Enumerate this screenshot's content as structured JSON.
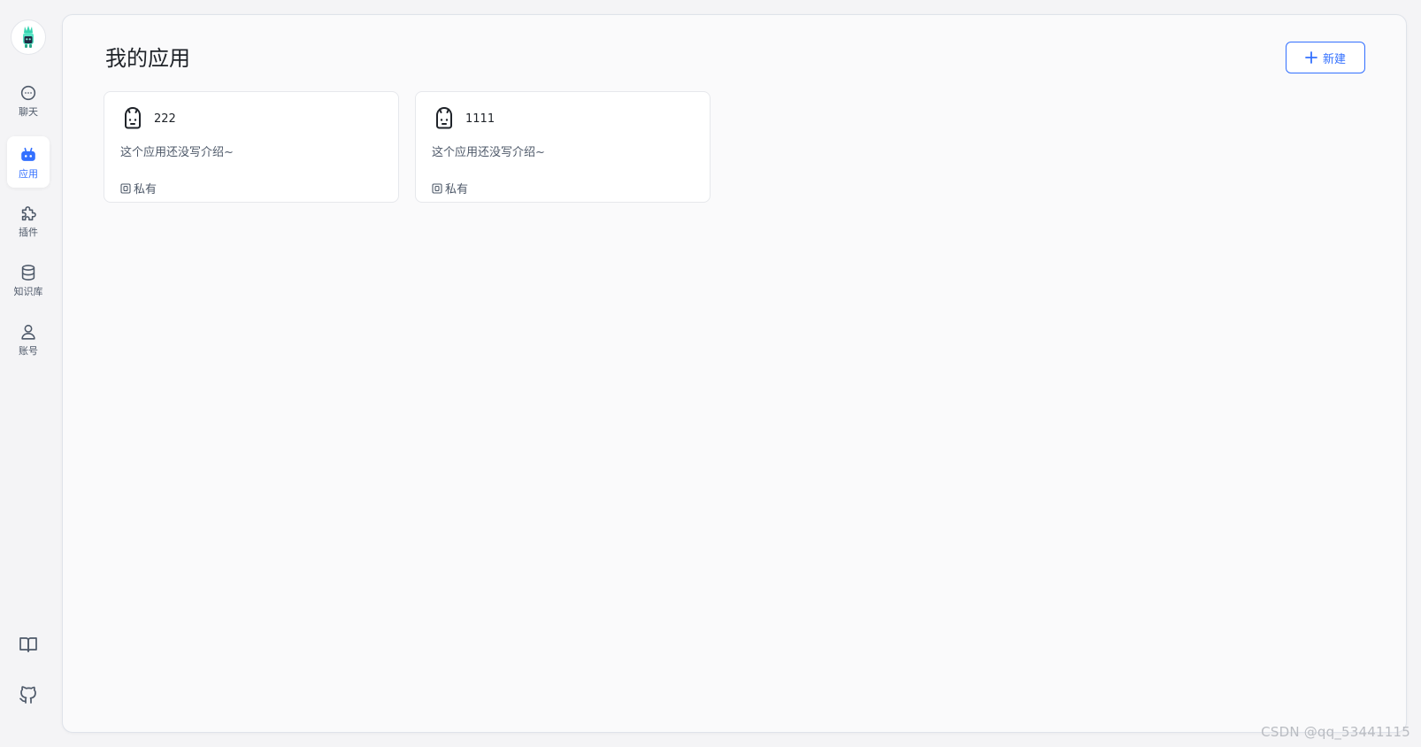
{
  "sidebar": {
    "avatar_icon": "app-logo-icon",
    "items": [
      {
        "label": "聊天",
        "icon": "chat-icon",
        "active": false
      },
      {
        "label": "应用",
        "icon": "robot-icon",
        "active": true
      },
      {
        "label": "插件",
        "icon": "puzzle-icon",
        "active": false
      },
      {
        "label": "知识库",
        "icon": "database-icon",
        "active": false
      },
      {
        "label": "账号",
        "icon": "user-icon",
        "active": false
      }
    ],
    "bottom": [
      {
        "icon": "book-icon"
      },
      {
        "icon": "github-icon"
      }
    ]
  },
  "main": {
    "title": "我的应用",
    "new_button_label": "新建",
    "cards": [
      {
        "name": "222",
        "description": "这个应用还没写介绍~",
        "visibility": "私有"
      },
      {
        "name": "1111",
        "description": "这个应用还没写介绍~",
        "visibility": "私有"
      }
    ]
  },
  "colors": {
    "accent": "#3370ff",
    "background": "#f4f4f6",
    "panel": "#fafafb"
  },
  "watermark": "CSDN @qq_53441115"
}
